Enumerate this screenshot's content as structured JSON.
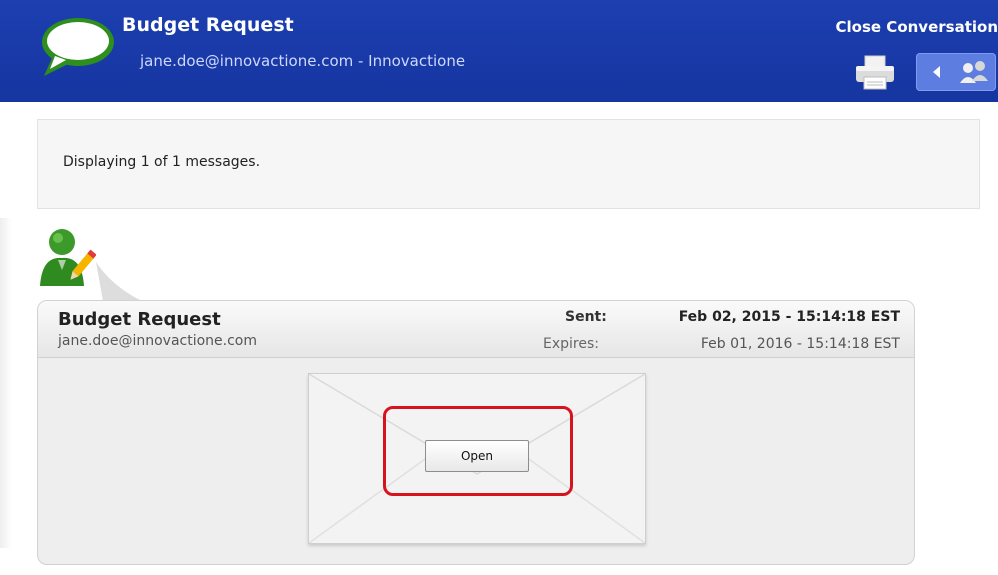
{
  "header": {
    "title": "Budget Request",
    "subtitle": "jane.doe@innovactione.com - Innovactione",
    "close_label": "Close Conversation",
    "icons": [
      "chat-bubble-icon",
      "printer-icon",
      "back-arrow-icon",
      "contacts-icon"
    ]
  },
  "info": {
    "display_text": "Displaying 1 of 1 messages."
  },
  "message": {
    "subject": "Budget Request",
    "from": "jane.doe@innovactione.com",
    "sent_label": "Sent:",
    "sent_value": "Feb 02, 2015 - 15:14:18 EST",
    "expires_label": "Expires:",
    "expires_value": "Feb 01, 2016 - 15:14:18 EST",
    "open_label": "Open"
  },
  "colors": {
    "header_bg": "#1a3aa8",
    "highlight": "#d6141e",
    "chat_icon_green": "#2f8f1e"
  }
}
